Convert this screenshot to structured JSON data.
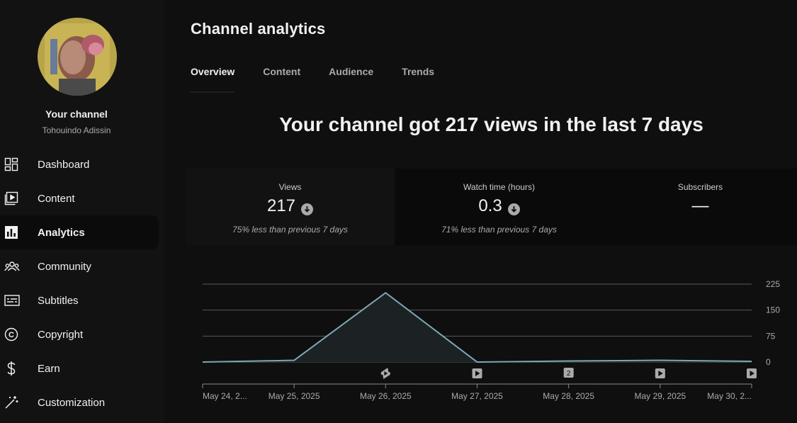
{
  "sidebar": {
    "channel_title": "Your channel",
    "channel_name": "Tohouindo Adissin",
    "items": [
      {
        "label": "Dashboard",
        "icon": "dashboard-icon"
      },
      {
        "label": "Content",
        "icon": "content-icon"
      },
      {
        "label": "Analytics",
        "icon": "analytics-icon",
        "active": true
      },
      {
        "label": "Community",
        "icon": "community-icon"
      },
      {
        "label": "Subtitles",
        "icon": "subtitles-icon"
      },
      {
        "label": "Copyright",
        "icon": "copyright-icon"
      },
      {
        "label": "Earn",
        "icon": "earn-icon"
      },
      {
        "label": "Customization",
        "icon": "customization-icon"
      }
    ]
  },
  "main": {
    "title": "Channel analytics",
    "tabs": [
      {
        "label": "Overview",
        "active": true
      },
      {
        "label": "Content"
      },
      {
        "label": "Audience"
      },
      {
        "label": "Trends"
      }
    ],
    "headline": "Your channel got 217 views in the last 7 days",
    "metrics": [
      {
        "label": "Views",
        "value": "217",
        "trend": "down",
        "compare": "75% less than previous 7 days"
      },
      {
        "label": "Watch time (hours)",
        "value": "0.3",
        "trend": "down",
        "compare": "71% less than previous 7 days"
      },
      {
        "label": "Subscribers",
        "value": "—"
      }
    ]
  },
  "chart_data": {
    "type": "area",
    "x": [
      "May 24, 2...",
      "May 25, 2025",
      "May 26, 2025",
      "May 27, 2025",
      "May 28, 2025",
      "May 29, 2025",
      "May 30, 2..."
    ],
    "series": [
      {
        "values": [
          0,
          5,
          200,
          0,
          3,
          5,
          2
        ]
      }
    ],
    "yticks": [
      "225",
      "150",
      "75",
      "0"
    ],
    "ylim": [
      0,
      225
    ],
    "markers": [
      {
        "x_index": 2,
        "kind": "shorts-icon"
      },
      {
        "x_index": 3,
        "kind": "video-icon"
      },
      {
        "x_index": 4,
        "kind": "count",
        "label": "2"
      },
      {
        "x_index": 5,
        "kind": "video-icon"
      },
      {
        "x_index": 6,
        "kind": "video-icon"
      }
    ],
    "grid": true,
    "colors": {
      "line": "#7fa7b5",
      "fill": "#1c2224",
      "grid": "#5a5a5a",
      "marker": "#aaaaaa"
    }
  }
}
